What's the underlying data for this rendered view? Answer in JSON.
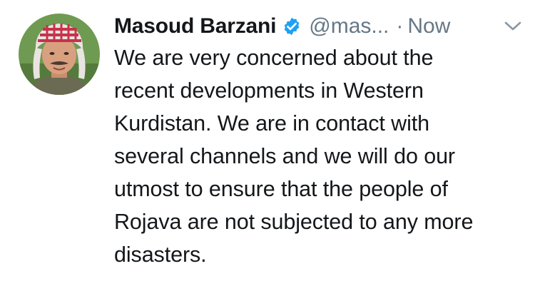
{
  "tweet": {
    "display_name": "Masoud Barzani",
    "verified_icon": "verified-badge-icon",
    "handle": "@mas...",
    "separator": "·",
    "timestamp": "Now",
    "menu_icon": "chevron-down-icon",
    "avatar_icon": "profile-photo",
    "text_lines": [
      "We are very concerned about the",
      "recent developments in Western",
      "Kurdistan. We are in contact with",
      "several channels and we will do our",
      "utmost to ensure that the people of",
      "Rojava are not subjected to any more",
      "disasters."
    ]
  },
  "colors": {
    "name": "#14171a",
    "secondary": "#657786",
    "verified": "#1da1f2",
    "background": "#ffffff"
  }
}
